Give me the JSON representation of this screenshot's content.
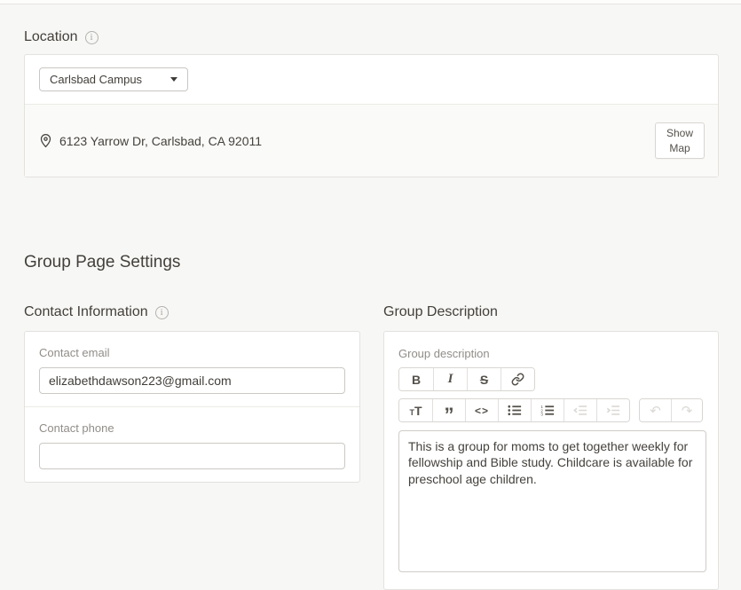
{
  "location": {
    "title": "Location",
    "campus_selected": "Carlsbad Campus",
    "address": "6123 Yarrow Dr, Carlsbad, CA 92011",
    "show_map_line1": "Show",
    "show_map_line2": "Map"
  },
  "group_page_settings_title": "Group Page Settings",
  "contact_information": {
    "title": "Contact Information",
    "email_label": "Contact email",
    "email_value": "elizabethdawson223@gmail.com",
    "phone_label": "Contact phone",
    "phone_value": ""
  },
  "group_description": {
    "title": "Group Description",
    "field_label": "Group description",
    "text": "This is a group for moms to get together weekly for fellowship and Bible study. Childcare is available for preschool age children.",
    "toolbar": {
      "bold_glyph": "B",
      "italic_glyph": "I",
      "strikethrough_glyph": "S",
      "heading_small_glyph": "T",
      "heading_large_glyph": "T",
      "quote_glyph": "”",
      "code_glyph": "<>",
      "undo_glyph": "↶",
      "redo_glyph": "↷",
      "icon_names": [
        "bold-icon",
        "italic-icon",
        "strikethrough-icon",
        "link-icon",
        "heading-icon",
        "quote-icon",
        "code-icon",
        "bullet-list-icon",
        "numbered-list-icon",
        "outdent-icon",
        "indent-icon",
        "undo-icon",
        "redo-icon"
      ],
      "disabled_buttons": [
        "outdent",
        "indent",
        "undo",
        "redo"
      ]
    }
  },
  "icons": {
    "info": "info-circle-icon",
    "map_pin": "map-pin-icon",
    "select_caret": "chevron-down-icon"
  },
  "colors": {
    "page_background": "#f7f7f5",
    "panel_background": "#ffffff",
    "panel_border": "#e3e2df",
    "heading_text": "#44403b",
    "label_text": "#918d88",
    "icon_enabled": "#55514b",
    "icon_disabled": "#dbd9d5"
  }
}
